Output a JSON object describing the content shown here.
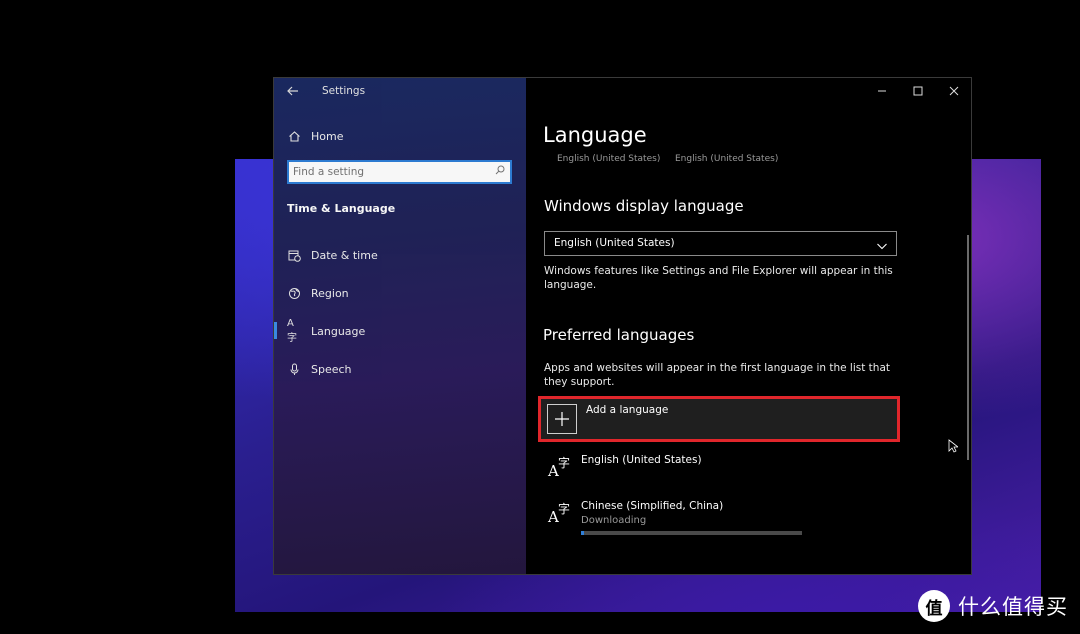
{
  "window": {
    "title": "Settings",
    "back_icon": "arrow-left-icon",
    "controls": [
      "minimize-icon",
      "maximize-icon",
      "close-icon"
    ]
  },
  "sidebar": {
    "home": {
      "label": "Home",
      "icon": "home-icon"
    },
    "search": {
      "placeholder": "Find a setting",
      "icon": "search-icon"
    },
    "section_title": "Time & Language",
    "items": [
      {
        "label": "Date & time",
        "icon": "calendar-clock-icon"
      },
      {
        "label": "Region",
        "icon": "globe-icon"
      },
      {
        "label": "Language",
        "icon": "language-icon",
        "selected": true
      },
      {
        "label": "Speech",
        "icon": "microphone-icon"
      }
    ],
    "accent_color": "#3c8ee8"
  },
  "main": {
    "title": "Language",
    "subtitles": [
      "English (United States)",
      "English (United States)"
    ],
    "display_language": {
      "heading": "Windows display language",
      "selected": "English (United States)",
      "description": "Windows features like Settings and File Explorer will appear in this language."
    },
    "preferred": {
      "heading": "Preferred languages",
      "description": "Apps and websites will appear in the first language in the list that they support.",
      "add_label": "Add a language",
      "highlight_color": "#e0262b",
      "languages": [
        {
          "name": "English (United States)",
          "status": ""
        },
        {
          "name": "Chinese (Simplified, China)",
          "status": "Downloading",
          "progress": 0.01
        }
      ]
    }
  },
  "watermark": {
    "logo_char": "值",
    "text": "什么值得买"
  }
}
